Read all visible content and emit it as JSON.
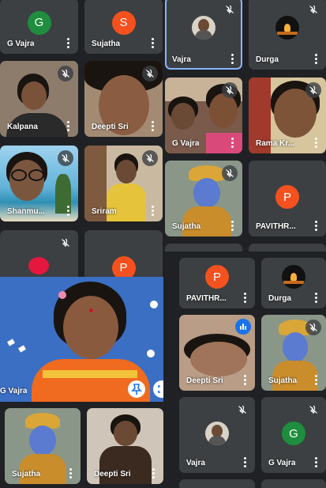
{
  "colors": {
    "background": "#1b1c1e",
    "tile": "#3c4043",
    "selected_outline": "#8ab4f8",
    "avatar_green": "#1e8e3e",
    "avatar_orange": "#f4511e",
    "speaking_blue": "#1a73e8"
  },
  "icons": {
    "mic_off": "mic-off-icon",
    "more": "more-vert-icon",
    "speaking": "audio-level-icon",
    "pin": "pin-icon"
  },
  "window_left": {
    "tiles": [
      {
        "name": "G Vajra",
        "avatar": "G"
      },
      {
        "name": "Sujatha",
        "avatar": "S"
      },
      {
        "name": "Kalpana"
      },
      {
        "name": "Deepti Sri"
      },
      {
        "name": "Shanmu..."
      },
      {
        "name": "Sriram"
      }
    ],
    "bottom_tile_avatar": "P"
  },
  "window_right": {
    "tiles": [
      {
        "name": "Vajra"
      },
      {
        "name": "Durga"
      },
      {
        "name": "G Vajra"
      },
      {
        "name": "Rama Kr..."
      },
      {
        "name": "Sujatha"
      },
      {
        "name": "PAVITHR...",
        "avatar": "P"
      }
    ]
  },
  "window_lower_right": {
    "tiles": [
      {
        "name": "PAVITHR...",
        "avatar": "P"
      },
      {
        "name": "Durga"
      },
      {
        "name": "Deepti Sri"
      },
      {
        "name": "Sujatha"
      },
      {
        "name": "Vajra"
      },
      {
        "name": "G Vajra",
        "avatar": "G"
      }
    ]
  },
  "spotlight": {
    "name": "G Vajra"
  },
  "window_bottom_left": {
    "tiles": [
      {
        "name": "Sujatha"
      },
      {
        "name": "Deepti Sri"
      }
    ]
  }
}
